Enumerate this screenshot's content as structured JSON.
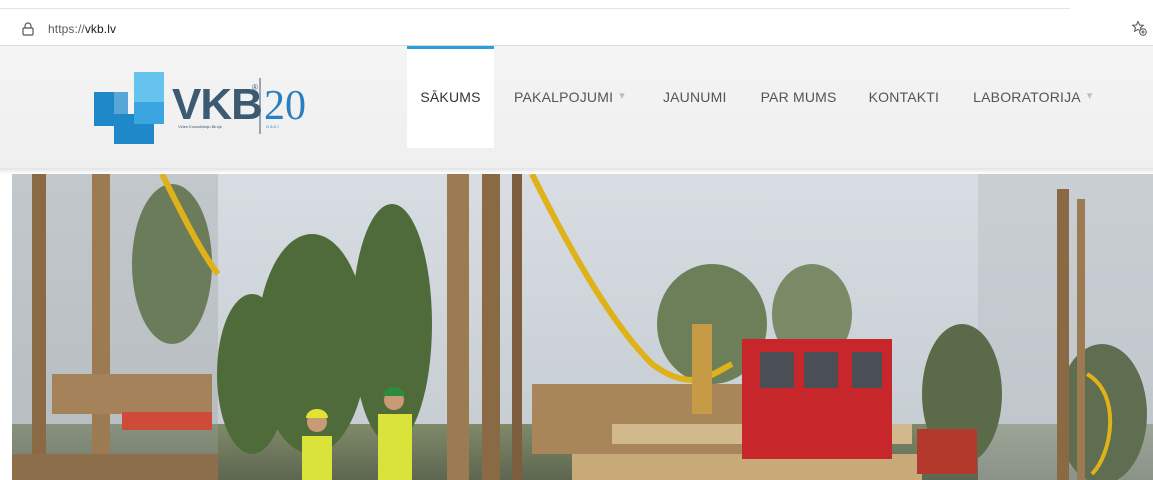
{
  "browser": {
    "url_scheme": "https://",
    "url_host": "vkb.lv",
    "lock_icon": "lock-icon",
    "bookmark_icon": "star-icon"
  },
  "logo": {
    "brand": "VKB",
    "years": "20",
    "tagline": "Vides Konsultāciju Birojs",
    "years_word": "G A D I"
  },
  "nav": {
    "items": [
      {
        "label": "SĀKUMS",
        "active": true,
        "dropdown": false
      },
      {
        "label": "PAKALPOJUMI",
        "active": false,
        "dropdown": true
      },
      {
        "label": "JAUNUMI",
        "active": false,
        "dropdown": false
      },
      {
        "label": "PAR MUMS",
        "active": false,
        "dropdown": false
      },
      {
        "label": "KONTAKTI",
        "active": false,
        "dropdown": false
      },
      {
        "label": "LABORATORIJA",
        "active": false,
        "dropdown": true
      }
    ],
    "caret": "▾"
  },
  "colors": {
    "accent": "#2aa0db",
    "logo_blue": "#1f88c9",
    "logo_light_blue": "#66c3ee",
    "logo_gray": "#3d5a73",
    "truck_red": "#c7262b",
    "hose_yellow": "#e0b21a"
  },
  "hero": {
    "description_icon": "drilling-rig-photo"
  }
}
